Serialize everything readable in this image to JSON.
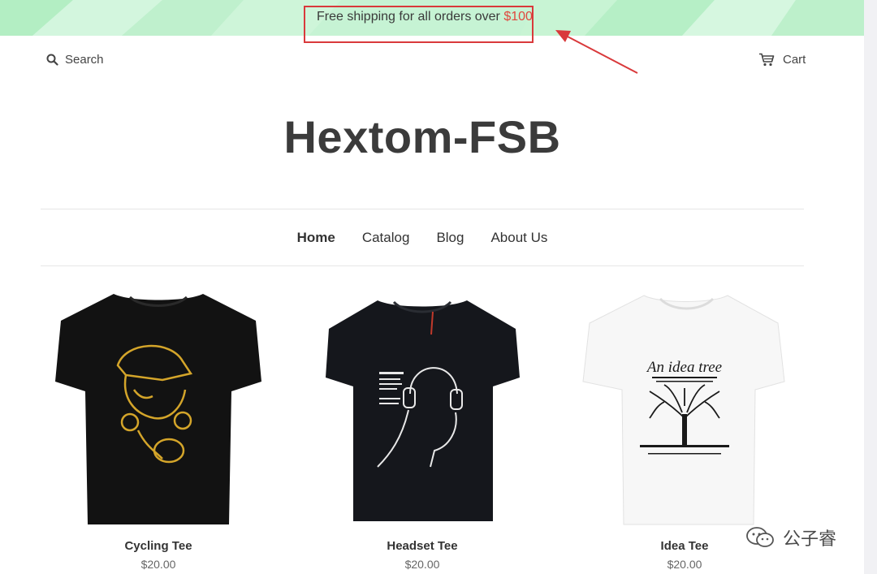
{
  "announcement": {
    "text": "Free shipping for all orders over ",
    "amount": "$100"
  },
  "header": {
    "search_label": "Search",
    "cart_label": "Cart",
    "logo": "Hextom-FSB"
  },
  "nav": {
    "items": [
      "Home",
      "Catalog",
      "Blog",
      "About Us"
    ],
    "active": "Home"
  },
  "products": [
    {
      "name": "Cycling Tee",
      "price": "$20.00",
      "shirt_color": "#121212",
      "print_color": "#d4a52a"
    },
    {
      "name": "Headset Tee",
      "price": "$20.00",
      "shirt_color": "#15171c",
      "print_color": "#e8e8e8"
    },
    {
      "name": "Idea Tee",
      "price": "$20.00",
      "shirt_color": "#f7f7f7",
      "print_color": "#1a1a1a",
      "print_text": "An idea tree"
    }
  ],
  "watermark": {
    "text": "公子睿"
  },
  "colors": {
    "accent_red": "#e0483e",
    "annotation_red": "#d9393b"
  }
}
